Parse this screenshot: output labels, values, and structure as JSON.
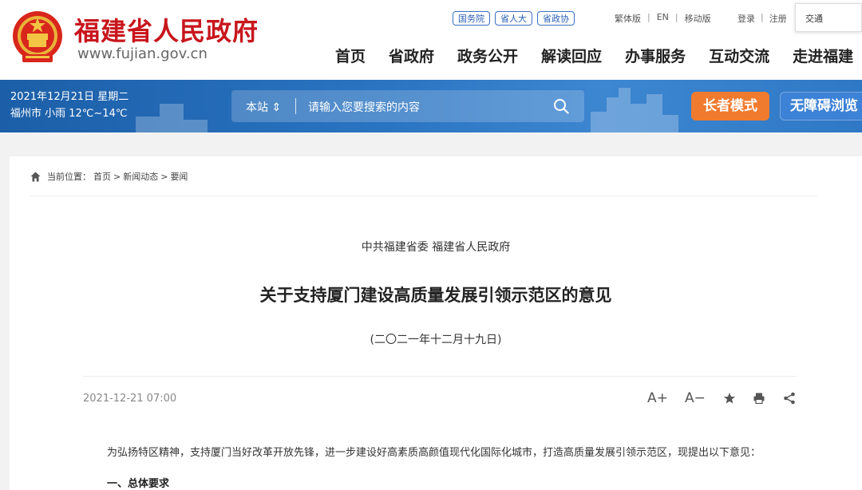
{
  "header": {
    "site_name": "福建省人民政府",
    "site_url": "www.fujian.gov.cn",
    "badges": [
      "国务院",
      "省人大",
      "省政协"
    ],
    "lang_links": [
      "繁体版",
      "EN",
      "移动版"
    ],
    "auth_links": [
      "登录",
      "注册"
    ],
    "search_value": "交通",
    "nav": [
      "首页",
      "省政府",
      "政务公开",
      "解读回应",
      "办事服务",
      "互动交流",
      "走进福建"
    ]
  },
  "band": {
    "date_line": "2021年12月21日 星期二",
    "weather_line": "福州市 小雨 12℃~14℃",
    "search_scope": "本站 ⇕",
    "search_placeholder": "请输入您要搜索的内容",
    "elder_mode_label": "长者模式",
    "accessible_label": "无障碍浏览"
  },
  "breadcrumb": {
    "prefix": "当前位置：",
    "items": [
      "首页",
      ">",
      "新闻动态",
      ">",
      "要闻"
    ]
  },
  "article": {
    "issuer": "中共福建省委 福建省人民政府",
    "title": "关于支持厦门建设高质量发展引领示范区的意见",
    "doc_date": "(二〇二一年十二月十九日)",
    "publish_time": "2021-12-21 07:00",
    "tools": {
      "font_bigger": "A+",
      "font_smaller": "A−"
    },
    "intro": "为弘扬特区精神，支持厦门当好改革开放先锋，进一步建设好高素质高颜值现代化国际化城市，打造高质量发展引领示范区，现提出以下意见：",
    "section_1": "一、总体要求"
  },
  "colors": {
    "brand_red": "#c8161d",
    "band_blue": "#2a74c2",
    "elder_orange": "#f07b2e",
    "badge_blue": "#2b5fb5"
  }
}
